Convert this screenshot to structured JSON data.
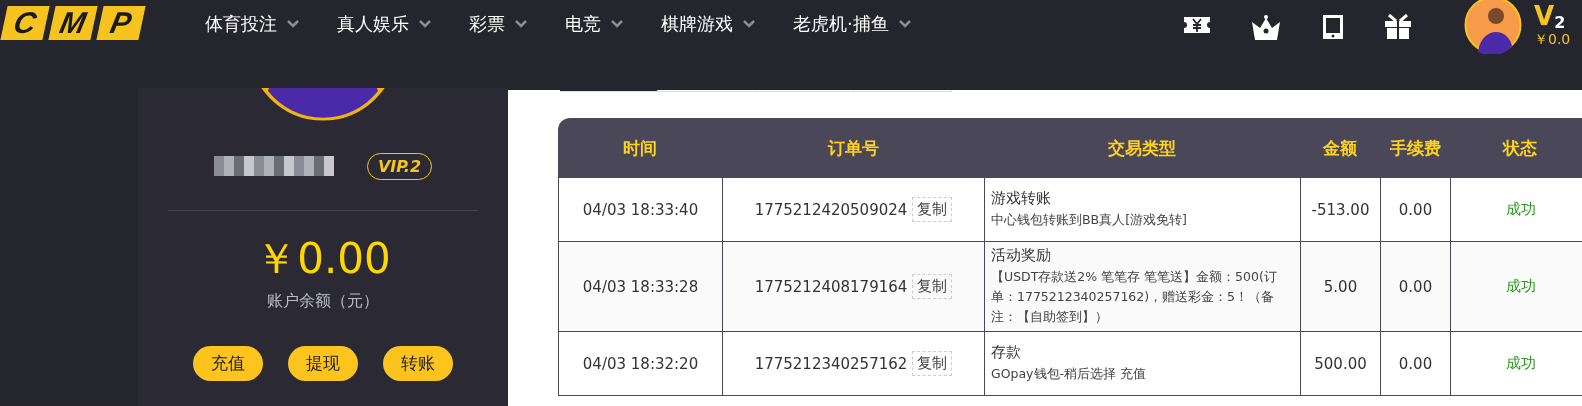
{
  "logo": {
    "letters": [
      "C",
      "M",
      "P"
    ]
  },
  "nav": [
    {
      "label": "体育投注"
    },
    {
      "label": "真人娱乐"
    },
    {
      "label": "彩票"
    },
    {
      "label": "电竞"
    },
    {
      "label": "棋牌游戏"
    },
    {
      "label": "老虎机·捕鱼"
    }
  ],
  "header_user": {
    "vip_letter": "V",
    "vip_level": "2",
    "balance": "￥0.0"
  },
  "sidebar": {
    "vip_badge": "VIP.2",
    "balance": "￥0.00",
    "balance_label": "账户余额（元）",
    "buttons": [
      "充值",
      "提现",
      "转账"
    ]
  },
  "table": {
    "columns": [
      "时间",
      "订单号",
      "交易类型",
      "金额",
      "手续费",
      "状态"
    ],
    "rows": [
      {
        "time": "04/03 18:33:40",
        "order": "1775212420509024",
        "copy": "复制",
        "type": "游戏转账",
        "detail": "中心钱包转账到BB真人[游戏免转]",
        "amount": "-513.00",
        "fee": "0.00",
        "status": "成功"
      },
      {
        "time": "04/03 18:33:28",
        "order": "1775212408179164",
        "copy": "复制",
        "type": "活动奖励",
        "detail": "【USDT存款送2% 笔笔存 笔笔送】金额：500(订单：1775212340257162)，赠送彩金：5！（备注：【自助签到】）",
        "amount": "5.00",
        "fee": "0.00",
        "status": "成功"
      },
      {
        "time": "04/03 18:32:20",
        "order": "1775212340257162",
        "copy": "复制",
        "type": "存款",
        "detail": "GOpay钱包-稍后选择 充值",
        "amount": "500.00",
        "fee": "0.00",
        "status": "成功"
      }
    ]
  }
}
